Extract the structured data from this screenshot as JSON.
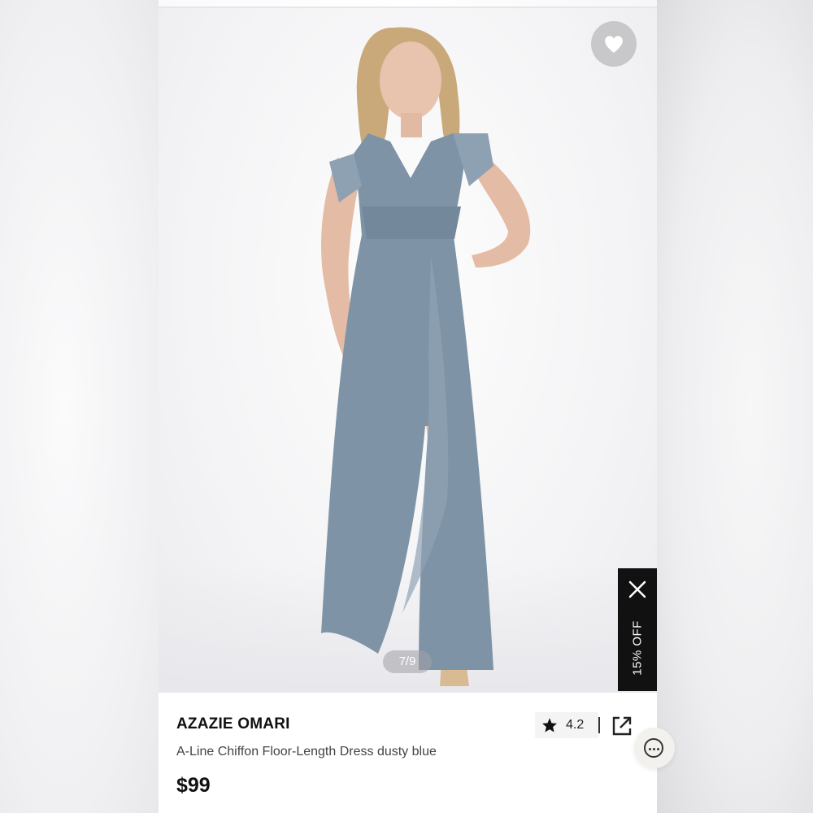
{
  "product": {
    "brand": "AZAZIE OMARI",
    "name": "A-Line Chiffon Floor-Length Dress dusty blue",
    "price": "$99",
    "rating": "4.2"
  },
  "gallery": {
    "counter": "7/9",
    "image_alt": "Model wearing dusty blue chiffon floor-length dress"
  },
  "promo": {
    "label": "15% OFF"
  },
  "icons": {
    "favorite": "heart-icon",
    "close": "close-icon",
    "star": "star-icon",
    "share": "share-icon",
    "chat": "chat-icon"
  },
  "colors": {
    "dress": "#7f93a6",
    "promo_bg": "#111111",
    "fav_bg": "#c8c8ca"
  }
}
